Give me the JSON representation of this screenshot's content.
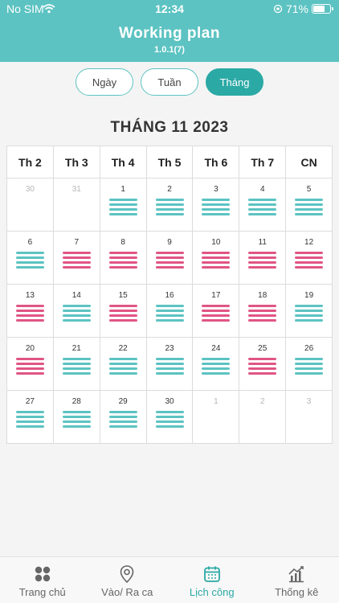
{
  "status_bar": {
    "carrier": "No SIM",
    "time": "12:34",
    "battery": "71%",
    "battery_fraction": 0.71
  },
  "header": {
    "title": "Working plan",
    "version": "1.0.1(7)"
  },
  "view_tabs": [
    {
      "label": "Ngày",
      "active": false
    },
    {
      "label": "Tuần",
      "active": false
    },
    {
      "label": "Tháng",
      "active": true
    }
  ],
  "calendar": {
    "title": "THÁNG 11 2023",
    "weekdays": [
      "Th 2",
      "Th 3",
      "Th 4",
      "Th 5",
      "Th 6",
      "Th 7",
      "CN"
    ],
    "colors": {
      "teal": "#5cc3c2",
      "pink": "#e05585"
    },
    "weeks": [
      [
        {
          "day": "30",
          "other": true,
          "shift": null
        },
        {
          "day": "31",
          "other": true,
          "shift": null
        },
        {
          "day": "1",
          "shift": "teal"
        },
        {
          "day": "2",
          "shift": "teal"
        },
        {
          "day": "3",
          "shift": "teal"
        },
        {
          "day": "4",
          "shift": "teal"
        },
        {
          "day": "5",
          "shift": "teal"
        }
      ],
      [
        {
          "day": "6",
          "shift": "teal"
        },
        {
          "day": "7",
          "shift": "pink"
        },
        {
          "day": "8",
          "shift": "pink"
        },
        {
          "day": "9",
          "shift": "pink"
        },
        {
          "day": "10",
          "shift": "pink"
        },
        {
          "day": "11",
          "shift": "pink"
        },
        {
          "day": "12",
          "shift": "pink"
        }
      ],
      [
        {
          "day": "13",
          "shift": "pink"
        },
        {
          "day": "14",
          "shift": "teal"
        },
        {
          "day": "15",
          "shift": "pink"
        },
        {
          "day": "16",
          "shift": "teal"
        },
        {
          "day": "17",
          "shift": "pink"
        },
        {
          "day": "18",
          "shift": "pink"
        },
        {
          "day": "19",
          "shift": "teal"
        }
      ],
      [
        {
          "day": "20",
          "shift": "pink"
        },
        {
          "day": "21",
          "shift": "teal"
        },
        {
          "day": "22",
          "shift": "teal"
        },
        {
          "day": "23",
          "shift": "teal"
        },
        {
          "day": "24",
          "shift": "teal"
        },
        {
          "day": "25",
          "shift": "pink"
        },
        {
          "day": "26",
          "shift": "teal"
        }
      ],
      [
        {
          "day": "27",
          "shift": "teal"
        },
        {
          "day": "28",
          "shift": "teal"
        },
        {
          "day": "29",
          "shift": "teal"
        },
        {
          "day": "30",
          "shift": "teal"
        },
        {
          "day": "1",
          "other": true,
          "shift": null
        },
        {
          "day": "2",
          "other": true,
          "shift": null
        },
        {
          "day": "3",
          "other": true,
          "shift": null
        }
      ]
    ]
  },
  "tabbar": [
    {
      "label": "Trang chủ",
      "icon": "grid-icon",
      "active": false
    },
    {
      "label": "Vào/ Ra ca",
      "icon": "location-pin-icon",
      "active": false
    },
    {
      "label": "Lịch công",
      "icon": "calendar-icon",
      "active": true
    },
    {
      "label": "Thống kê",
      "icon": "chart-icon",
      "active": false
    }
  ]
}
